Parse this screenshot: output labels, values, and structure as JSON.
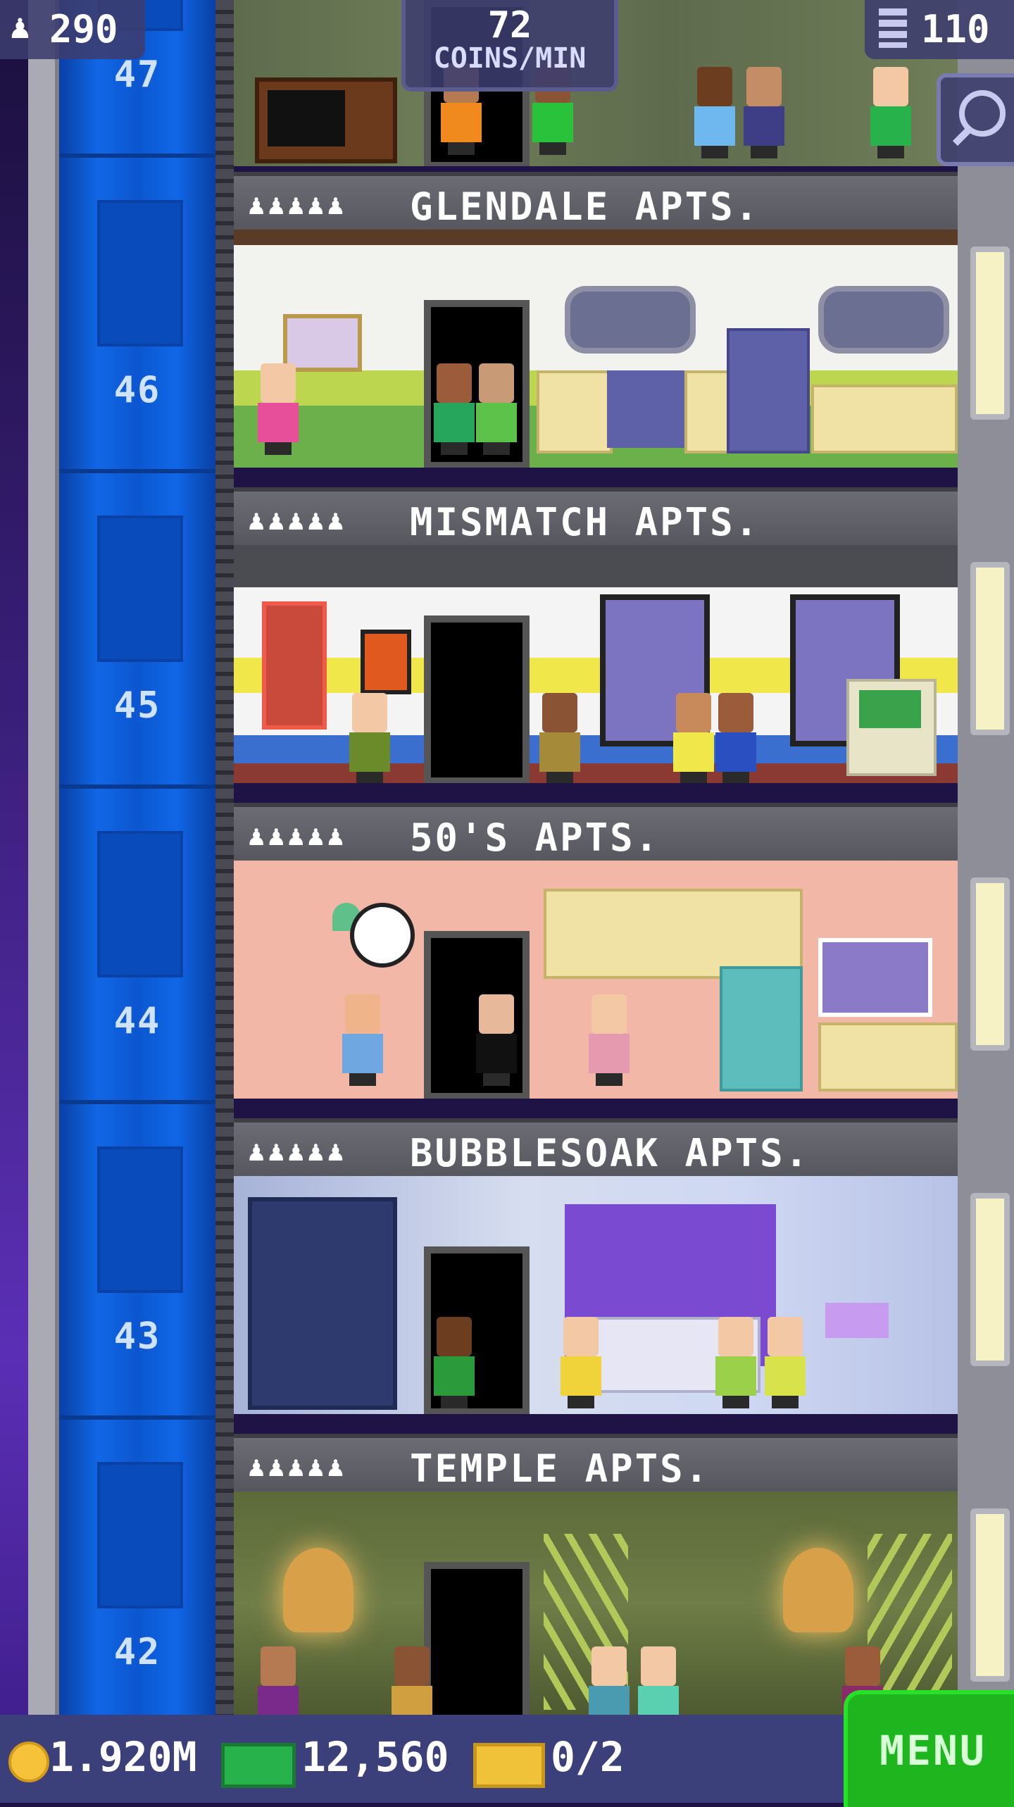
{
  "hud": {
    "population": "290",
    "coins_per_min_value": "72",
    "coins_per_min_label": "COINS/MIN",
    "floors_count": "110"
  },
  "floors": [
    {
      "number": "47",
      "label": null
    },
    {
      "number": "46",
      "label": "GLENDALE APTS."
    },
    {
      "number": "45",
      "label": "MISMATCH APTS."
    },
    {
      "number": "44",
      "label": "50'S APTS."
    },
    {
      "number": "43",
      "label": "BUBBLESOAK APTS."
    },
    {
      "number": "42",
      "label": "TEMPLE APTS."
    }
  ],
  "labels": {
    "glendale": "GLENDALE APTS.",
    "mismatch": "MISMATCH APTS.",
    "fifties": "50'S APTS.",
    "bubblesoak": "BUBBLESOAK APTS.",
    "temple": "TEMPLE APTS."
  },
  "residents_icons": "♟♟♟♟♟",
  "bottom": {
    "coins": "1.920M",
    "bux": "12,560",
    "tickets": "0/2",
    "menu_label": "MENU"
  },
  "colors": {
    "elevator_shaft": "#0b4fc6",
    "menu_green": "#1fb51f",
    "hud_panel": "#3c3c6e"
  },
  "icons": [
    "person-icon",
    "floors-icon",
    "search-zoom-icon",
    "coin-icon",
    "bux-icon",
    "ticket-icon"
  ]
}
